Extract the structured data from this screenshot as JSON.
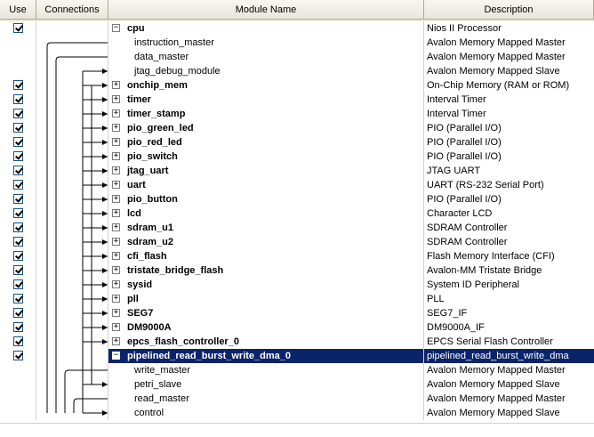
{
  "columns": {
    "use": "Use",
    "connections": "Connections",
    "module_name": "Module Name",
    "description": "Description"
  },
  "expander_plus": "+",
  "expander_minus": "−",
  "rows": [
    {
      "kind": "module",
      "name": "cpu",
      "description": "Nios II Processor",
      "checked": true,
      "expanded": true
    },
    {
      "kind": "port",
      "name": "instruction_master",
      "description": "Avalon Memory Mapped Master"
    },
    {
      "kind": "port",
      "name": "data_master",
      "description": "Avalon Memory Mapped Master"
    },
    {
      "kind": "port",
      "name": "jtag_debug_module",
      "description": "Avalon Memory Mapped Slave"
    },
    {
      "kind": "module",
      "name": "onchip_mem",
      "description": "On-Chip Memory (RAM or ROM)",
      "checked": true
    },
    {
      "kind": "module",
      "name": "timer",
      "description": "Interval Timer",
      "checked": true
    },
    {
      "kind": "module",
      "name": "timer_stamp",
      "description": "Interval Timer",
      "checked": true
    },
    {
      "kind": "module",
      "name": "pio_green_led",
      "description": "PIO (Parallel I/O)",
      "checked": true
    },
    {
      "kind": "module",
      "name": "pio_red_led",
      "description": "PIO (Parallel I/O)",
      "checked": true
    },
    {
      "kind": "module",
      "name": "pio_switch",
      "description": "PIO (Parallel I/O)",
      "checked": true
    },
    {
      "kind": "module",
      "name": "jtag_uart",
      "description": "JTAG UART",
      "checked": true
    },
    {
      "kind": "module",
      "name": "uart",
      "description": "UART (RS-232 Serial Port)",
      "checked": true
    },
    {
      "kind": "module",
      "name": "pio_button",
      "description": "PIO (Parallel I/O)",
      "checked": true
    },
    {
      "kind": "module",
      "name": "lcd",
      "description": "Character LCD",
      "checked": true
    },
    {
      "kind": "module",
      "name": "sdram_u1",
      "description": "SDRAM Controller",
      "checked": true
    },
    {
      "kind": "module",
      "name": "sdram_u2",
      "description": "SDRAM Controller",
      "checked": true
    },
    {
      "kind": "module",
      "name": "cfi_flash",
      "description": "Flash Memory Interface (CFI)",
      "checked": true
    },
    {
      "kind": "module",
      "name": "tristate_bridge_flash",
      "description": "Avalon-MM Tristate Bridge",
      "checked": true
    },
    {
      "kind": "module",
      "name": "sysid",
      "description": "System ID Peripheral",
      "checked": true
    },
    {
      "kind": "module",
      "name": "pll",
      "description": "PLL",
      "checked": true
    },
    {
      "kind": "module",
      "name": "SEG7",
      "description": "SEG7_IF",
      "checked": true
    },
    {
      "kind": "module",
      "name": "DM9000A",
      "description": "DM9000A_IF",
      "checked": true
    },
    {
      "kind": "module",
      "name": "epcs_flash_controller_0",
      "description": "EPCS Serial Flash Controller",
      "checked": true
    },
    {
      "kind": "module",
      "name": "pipelined_read_burst_write_dma_0",
      "description": "pipelined_read_burst_write_dma",
      "checked": true,
      "expanded": true,
      "selected": true
    },
    {
      "kind": "port",
      "name": "write_master",
      "description": "Avalon Memory Mapped Master"
    },
    {
      "kind": "port",
      "name": "petri_slave",
      "description": "Avalon Memory Mapped Slave"
    },
    {
      "kind": "port",
      "name": "read_master",
      "description": "Avalon Memory Mapped Master"
    },
    {
      "kind": "port",
      "name": "control",
      "description": "Avalon Memory Mapped Slave"
    }
  ]
}
